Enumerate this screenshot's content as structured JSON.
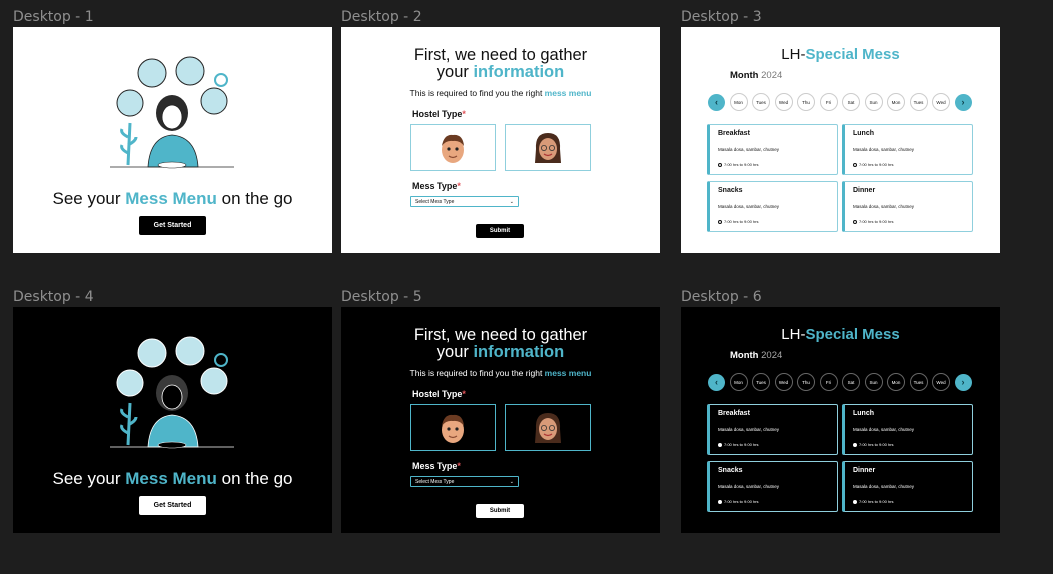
{
  "frames": [
    {
      "label": "Desktop - 1",
      "theme": "light"
    },
    {
      "label": "Desktop - 2",
      "theme": "light"
    },
    {
      "label": "Desktop - 3",
      "theme": "light"
    },
    {
      "label": "Desktop - 4",
      "theme": "dark"
    },
    {
      "label": "Desktop - 5",
      "theme": "dark"
    },
    {
      "label": "Desktop - 6",
      "theme": "dark"
    }
  ],
  "landing": {
    "hero_prefix": "See your ",
    "hero_accent": "Mess Menu",
    "hero_suffix": " on the go",
    "cta_label": "Get Started"
  },
  "form": {
    "title_line1": "First, we need to gather",
    "title_line2_prefix": "your ",
    "title_line2_accent": "information",
    "subtitle_prefix": "This is required to find you the right ",
    "subtitle_accent": "mess menu",
    "hostel_label": "Hostel Type",
    "mess_label": "Mess Type",
    "required_mark": "*",
    "select_placeholder": "Select Mess Type",
    "submit_label": "Submit"
  },
  "menu": {
    "title_prefix": "LH-",
    "title_accent": "Special Mess",
    "month_label": "Month",
    "year": "2024",
    "days": [
      "Mon",
      "Tues",
      "Wed",
      "Thu",
      "Fri",
      "Sat",
      "Sun",
      "Mon",
      "Tues",
      "Wed"
    ],
    "meals": [
      {
        "name": "Breakfast",
        "items": "Masala dosa, sambar, chutney",
        "time": "7:00 hrs to 9:00 hrs"
      },
      {
        "name": "Lunch",
        "items": "Masala dosa, sambar, chutney",
        "time": "7:00 hrs to 9:00 hrs"
      },
      {
        "name": "Snacks",
        "items": "Masala dosa, sambar, chutney",
        "time": "7:00 hrs to 9:00 hrs"
      },
      {
        "name": "Dinner",
        "items": "Masala dosa, sambar, chutney",
        "time": "7:00 hrs to 9:00 hrs"
      }
    ]
  },
  "colors": {
    "accent": "#4fb5c9",
    "canvas": "#1e1e1e",
    "required": "#e0545a"
  }
}
